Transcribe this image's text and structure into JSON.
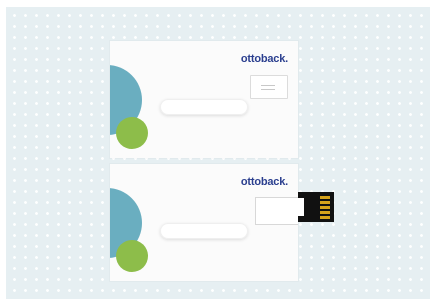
{
  "brand": "ottoback.",
  "colors": {
    "background": "#e6eff2",
    "card": "#fbfbfb",
    "brand": "#2b3f8f",
    "blue_circle": "#6aaec0",
    "green_circle": "#8dbd4a",
    "usb_metal": "#111111",
    "usb_pins": "#d6a31b"
  }
}
